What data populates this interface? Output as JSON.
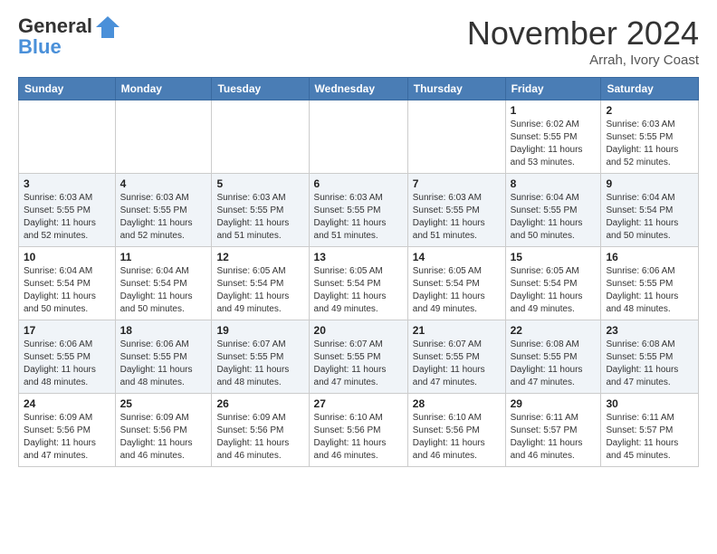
{
  "header": {
    "logo_line1": "General",
    "logo_line2": "Blue",
    "month": "November 2024",
    "location": "Arrah, Ivory Coast"
  },
  "weekdays": [
    "Sunday",
    "Monday",
    "Tuesday",
    "Wednesday",
    "Thursday",
    "Friday",
    "Saturday"
  ],
  "weeks": [
    [
      {
        "day": "",
        "info": ""
      },
      {
        "day": "",
        "info": ""
      },
      {
        "day": "",
        "info": ""
      },
      {
        "day": "",
        "info": ""
      },
      {
        "day": "",
        "info": ""
      },
      {
        "day": "1",
        "info": "Sunrise: 6:02 AM\nSunset: 5:55 PM\nDaylight: 11 hours\nand 53 minutes."
      },
      {
        "day": "2",
        "info": "Sunrise: 6:03 AM\nSunset: 5:55 PM\nDaylight: 11 hours\nand 52 minutes."
      }
    ],
    [
      {
        "day": "3",
        "info": "Sunrise: 6:03 AM\nSunset: 5:55 PM\nDaylight: 11 hours\nand 52 minutes."
      },
      {
        "day": "4",
        "info": "Sunrise: 6:03 AM\nSunset: 5:55 PM\nDaylight: 11 hours\nand 52 minutes."
      },
      {
        "day": "5",
        "info": "Sunrise: 6:03 AM\nSunset: 5:55 PM\nDaylight: 11 hours\nand 51 minutes."
      },
      {
        "day": "6",
        "info": "Sunrise: 6:03 AM\nSunset: 5:55 PM\nDaylight: 11 hours\nand 51 minutes."
      },
      {
        "day": "7",
        "info": "Sunrise: 6:03 AM\nSunset: 5:55 PM\nDaylight: 11 hours\nand 51 minutes."
      },
      {
        "day": "8",
        "info": "Sunrise: 6:04 AM\nSunset: 5:55 PM\nDaylight: 11 hours\nand 50 minutes."
      },
      {
        "day": "9",
        "info": "Sunrise: 6:04 AM\nSunset: 5:54 PM\nDaylight: 11 hours\nand 50 minutes."
      }
    ],
    [
      {
        "day": "10",
        "info": "Sunrise: 6:04 AM\nSunset: 5:54 PM\nDaylight: 11 hours\nand 50 minutes."
      },
      {
        "day": "11",
        "info": "Sunrise: 6:04 AM\nSunset: 5:54 PM\nDaylight: 11 hours\nand 50 minutes."
      },
      {
        "day": "12",
        "info": "Sunrise: 6:05 AM\nSunset: 5:54 PM\nDaylight: 11 hours\nand 49 minutes."
      },
      {
        "day": "13",
        "info": "Sunrise: 6:05 AM\nSunset: 5:54 PM\nDaylight: 11 hours\nand 49 minutes."
      },
      {
        "day": "14",
        "info": "Sunrise: 6:05 AM\nSunset: 5:54 PM\nDaylight: 11 hours\nand 49 minutes."
      },
      {
        "day": "15",
        "info": "Sunrise: 6:05 AM\nSunset: 5:54 PM\nDaylight: 11 hours\nand 49 minutes."
      },
      {
        "day": "16",
        "info": "Sunrise: 6:06 AM\nSunset: 5:55 PM\nDaylight: 11 hours\nand 48 minutes."
      }
    ],
    [
      {
        "day": "17",
        "info": "Sunrise: 6:06 AM\nSunset: 5:55 PM\nDaylight: 11 hours\nand 48 minutes."
      },
      {
        "day": "18",
        "info": "Sunrise: 6:06 AM\nSunset: 5:55 PM\nDaylight: 11 hours\nand 48 minutes."
      },
      {
        "day": "19",
        "info": "Sunrise: 6:07 AM\nSunset: 5:55 PM\nDaylight: 11 hours\nand 48 minutes."
      },
      {
        "day": "20",
        "info": "Sunrise: 6:07 AM\nSunset: 5:55 PM\nDaylight: 11 hours\nand 47 minutes."
      },
      {
        "day": "21",
        "info": "Sunrise: 6:07 AM\nSunset: 5:55 PM\nDaylight: 11 hours\nand 47 minutes."
      },
      {
        "day": "22",
        "info": "Sunrise: 6:08 AM\nSunset: 5:55 PM\nDaylight: 11 hours\nand 47 minutes."
      },
      {
        "day": "23",
        "info": "Sunrise: 6:08 AM\nSunset: 5:55 PM\nDaylight: 11 hours\nand 47 minutes."
      }
    ],
    [
      {
        "day": "24",
        "info": "Sunrise: 6:09 AM\nSunset: 5:56 PM\nDaylight: 11 hours\nand 47 minutes."
      },
      {
        "day": "25",
        "info": "Sunrise: 6:09 AM\nSunset: 5:56 PM\nDaylight: 11 hours\nand 46 minutes."
      },
      {
        "day": "26",
        "info": "Sunrise: 6:09 AM\nSunset: 5:56 PM\nDaylight: 11 hours\nand 46 minutes."
      },
      {
        "day": "27",
        "info": "Sunrise: 6:10 AM\nSunset: 5:56 PM\nDaylight: 11 hours\nand 46 minutes."
      },
      {
        "day": "28",
        "info": "Sunrise: 6:10 AM\nSunset: 5:56 PM\nDaylight: 11 hours\nand 46 minutes."
      },
      {
        "day": "29",
        "info": "Sunrise: 6:11 AM\nSunset: 5:57 PM\nDaylight: 11 hours\nand 46 minutes."
      },
      {
        "day": "30",
        "info": "Sunrise: 6:11 AM\nSunset: 5:57 PM\nDaylight: 11 hours\nand 45 minutes."
      }
    ]
  ]
}
